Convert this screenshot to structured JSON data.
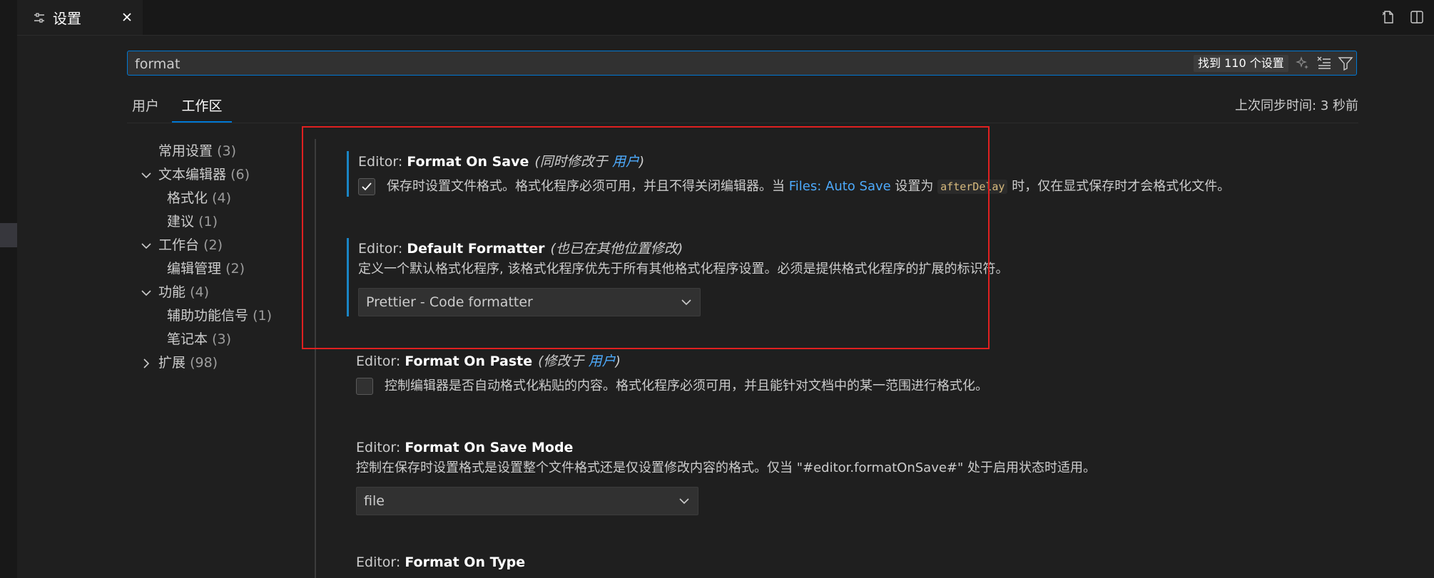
{
  "tab": {
    "title": "设置",
    "icon": "settings-sliders-icon",
    "close_icon": "close-icon"
  },
  "toolbar_icons": [
    "open-settings-json-icon",
    "split-editor-icon"
  ],
  "search": {
    "value": "format",
    "count_label": "找到 110 个设置",
    "icons": [
      "sparkle-icon",
      "clear-filter-icon",
      "filter-icon"
    ]
  },
  "scope_tabs": [
    {
      "label": "用户",
      "active": false
    },
    {
      "label": "工作区",
      "active": true
    }
  ],
  "sync_status": "上次同步时间: 3 秒前",
  "toc": [
    {
      "label": "常用设置",
      "count": "(3)",
      "chevron": "none"
    },
    {
      "label": "文本编辑器",
      "count": "(6)",
      "chevron": "down"
    },
    {
      "label": "格式化",
      "count": "(4)",
      "chevron": "none"
    },
    {
      "label": "建议",
      "count": "(1)",
      "chevron": "none"
    },
    {
      "label": "工作台",
      "count": "(2)",
      "chevron": "down"
    },
    {
      "label": "编辑管理",
      "count": "(2)",
      "chevron": "none"
    },
    {
      "label": "功能",
      "count": "(4)",
      "chevron": "down"
    },
    {
      "label": "辅助功能信号",
      "count": "(1)",
      "chevron": "none"
    },
    {
      "label": "笔记本",
      "count": "(3)",
      "chevron": "none"
    },
    {
      "label": "扩展",
      "count": "(98)",
      "chevron": "right"
    }
  ],
  "settings": {
    "format_on_save": {
      "category": "Editor: ",
      "name": "Format On Save",
      "modified_prefix": "(同时修改于 ",
      "modified_link": "用户",
      "modified_suffix": ")",
      "desc_before": "保存时设置文件格式。格式化程序必须可用，并且不得关闭编辑器。当 ",
      "desc_link": "Files: Auto Save",
      "desc_mid": " 设置为 ",
      "desc_code": "afterDelay",
      "desc_after": " 时，仅在显式保存时才会格式化文件。",
      "checked": true
    },
    "default_formatter": {
      "category": "Editor: ",
      "name": "Default Formatter",
      "modified_note": "(也已在其他位置修改)",
      "desc": "定义一个默认格式化程序, 该格式化程序优先于所有其他格式化程序设置。必须是提供格式化程序的扩展的标识符。",
      "value": "Prettier - Code formatter"
    },
    "format_on_paste": {
      "category": "Editor: ",
      "name": "Format On Paste",
      "modified_prefix": "(修改于 ",
      "modified_link": "用户",
      "modified_suffix": ")",
      "desc": "控制编辑器是否自动格式化粘贴的内容。格式化程序必须可用，并且能针对文档中的某一范围进行格式化。",
      "checked": false
    },
    "format_on_save_mode": {
      "category": "Editor: ",
      "name": "Format On Save Mode",
      "desc": "控制在保存时设置格式是设置整个文件格式还是仅设置修改内容的格式。仅当 \"#editor.formatOnSave#\" 处于启用状态时适用。",
      "value": "file"
    },
    "format_on_type": {
      "category": "Editor: ",
      "name": "Format On Type"
    }
  },
  "colors": {
    "accent": "#0078d4",
    "link": "#4daafc",
    "modified_bar": "#1a85c5",
    "highlight_box": "#e02020"
  }
}
